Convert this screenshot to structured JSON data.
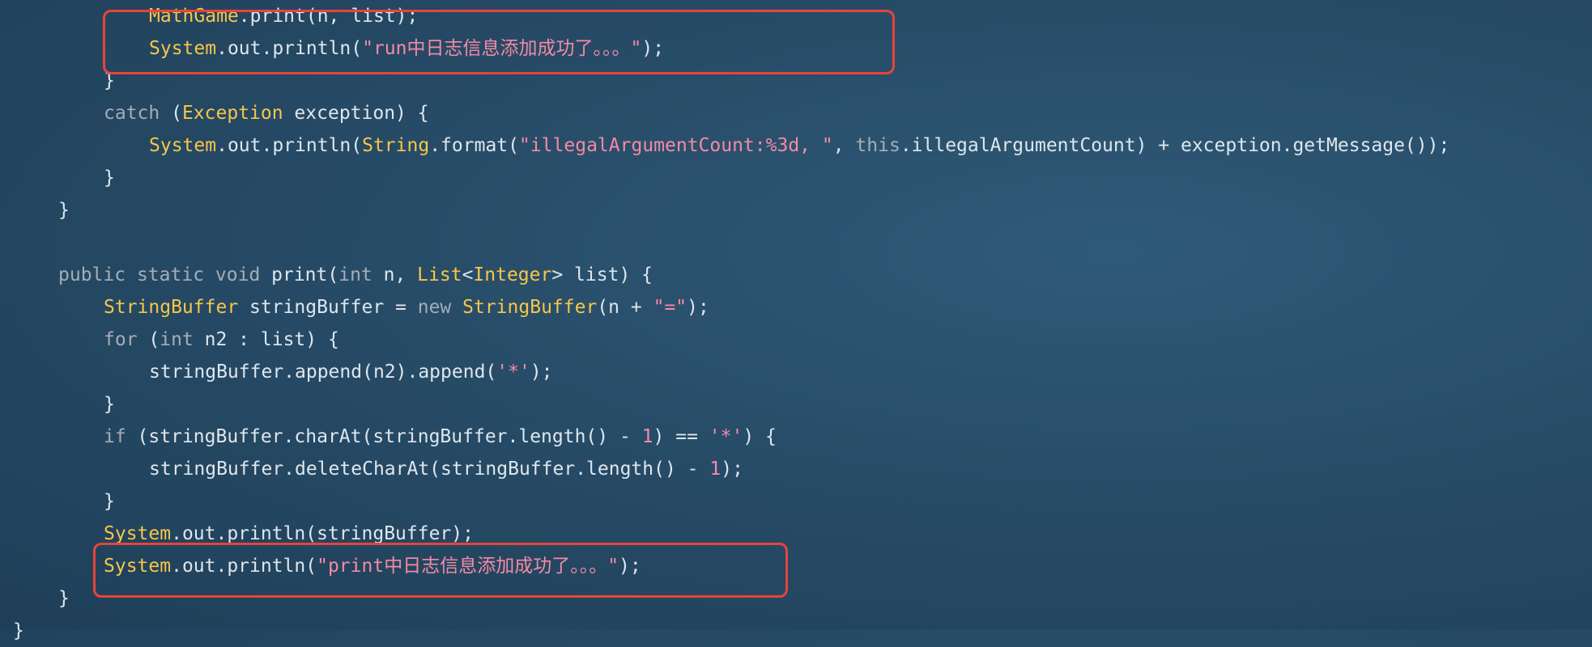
{
  "code": {
    "lines": [
      {
        "indent": 3,
        "tokens": [
          {
            "t": "MathGame",
            "k": "type"
          },
          {
            "t": ".print(n, list);",
            "k": "plain"
          }
        ]
      },
      {
        "indent": 3,
        "tokens": [
          {
            "t": "System",
            "k": "type"
          },
          {
            "t": ".out.println(",
            "k": "plain"
          },
          {
            "t": "\"run中日志信息添加成功了。。。\"",
            "k": "str"
          },
          {
            "t": ");",
            "k": "plain"
          }
        ]
      },
      {
        "indent": 2,
        "tokens": [
          {
            "t": "}",
            "k": "plain"
          }
        ]
      },
      {
        "indent": 2,
        "tokens": [
          {
            "t": "catch",
            "k": "kw"
          },
          {
            "t": " (",
            "k": "plain"
          },
          {
            "t": "Exception",
            "k": "type"
          },
          {
            "t": " exception) {",
            "k": "plain"
          }
        ]
      },
      {
        "indent": 3,
        "tokens": [
          {
            "t": "System",
            "k": "type"
          },
          {
            "t": ".out.println(",
            "k": "plain"
          },
          {
            "t": "String",
            "k": "type"
          },
          {
            "t": ".format(",
            "k": "plain"
          },
          {
            "t": "\"illegalArgumentCount:%3d, \"",
            "k": "str"
          },
          {
            "t": ", ",
            "k": "plain"
          },
          {
            "t": "this",
            "k": "kw"
          },
          {
            "t": ".illegalArgumentCount) + exception.getMessage());",
            "k": "plain"
          }
        ]
      },
      {
        "indent": 2,
        "tokens": [
          {
            "t": "}",
            "k": "plain"
          }
        ]
      },
      {
        "indent": 1,
        "tokens": [
          {
            "t": "}",
            "k": "plain"
          }
        ]
      },
      {
        "indent": 0,
        "tokens": []
      },
      {
        "indent": 1,
        "tokens": [
          {
            "t": "public",
            "k": "kw"
          },
          {
            "t": " ",
            "k": "plain"
          },
          {
            "t": "static",
            "k": "kw"
          },
          {
            "t": " ",
            "k": "plain"
          },
          {
            "t": "void",
            "k": "kw"
          },
          {
            "t": " print(",
            "k": "plain"
          },
          {
            "t": "int",
            "k": "kw"
          },
          {
            "t": " n, ",
            "k": "plain"
          },
          {
            "t": "List",
            "k": "type"
          },
          {
            "t": "<",
            "k": "plain"
          },
          {
            "t": "Integer",
            "k": "type"
          },
          {
            "t": "> list) {",
            "k": "plain"
          }
        ]
      },
      {
        "indent": 2,
        "tokens": [
          {
            "t": "StringBuffer",
            "k": "type"
          },
          {
            "t": " stringBuffer = ",
            "k": "plain"
          },
          {
            "t": "new",
            "k": "kw"
          },
          {
            "t": " ",
            "k": "plain"
          },
          {
            "t": "StringBuffer",
            "k": "type"
          },
          {
            "t": "(n + ",
            "k": "plain"
          },
          {
            "t": "\"=\"",
            "k": "str"
          },
          {
            "t": ");",
            "k": "plain"
          }
        ]
      },
      {
        "indent": 2,
        "tokens": [
          {
            "t": "for",
            "k": "kw"
          },
          {
            "t": " (",
            "k": "plain"
          },
          {
            "t": "int",
            "k": "kw"
          },
          {
            "t": " n2 : list) {",
            "k": "plain"
          }
        ]
      },
      {
        "indent": 3,
        "tokens": [
          {
            "t": "stringBuffer.append(n2).append(",
            "k": "plain"
          },
          {
            "t": "'*'",
            "k": "str"
          },
          {
            "t": ");",
            "k": "plain"
          }
        ]
      },
      {
        "indent": 2,
        "tokens": [
          {
            "t": "}",
            "k": "plain"
          }
        ]
      },
      {
        "indent": 2,
        "tokens": [
          {
            "t": "if",
            "k": "kw"
          },
          {
            "t": " (stringBuffer.charAt(stringBuffer.length() - ",
            "k": "plain"
          },
          {
            "t": "1",
            "k": "num"
          },
          {
            "t": ") == ",
            "k": "plain"
          },
          {
            "t": "'*'",
            "k": "str"
          },
          {
            "t": ") {",
            "k": "plain"
          }
        ]
      },
      {
        "indent": 3,
        "tokens": [
          {
            "t": "stringBuffer.deleteCharAt(stringBuffer.length() - ",
            "k": "plain"
          },
          {
            "t": "1",
            "k": "num"
          },
          {
            "t": ");",
            "k": "plain"
          }
        ]
      },
      {
        "indent": 2,
        "tokens": [
          {
            "t": "}",
            "k": "plain"
          }
        ]
      },
      {
        "indent": 2,
        "tokens": [
          {
            "t": "System",
            "k": "type"
          },
          {
            "t": ".out.println(stringBuffer);",
            "k": "plain"
          }
        ]
      },
      {
        "indent": 2,
        "tokens": [
          {
            "t": "System",
            "k": "type"
          },
          {
            "t": ".out.println(",
            "k": "plain"
          },
          {
            "t": "\"print中日志信息添加成功了。。。\"",
            "k": "str"
          },
          {
            "t": ");",
            "k": "plain"
          }
        ]
      },
      {
        "indent": 1,
        "tokens": [
          {
            "t": "}",
            "k": "plain"
          }
        ]
      },
      {
        "indent": 0,
        "tokens": [
          {
            "t": "}",
            "k": "plain"
          }
        ]
      }
    ]
  },
  "colors": {
    "keyword": "#a5adb6",
    "type": "#f6c64a",
    "string": "#f58aa4",
    "plain": "#dfe6ec",
    "highlight_border": "#e8443a",
    "background": "#274c68"
  }
}
